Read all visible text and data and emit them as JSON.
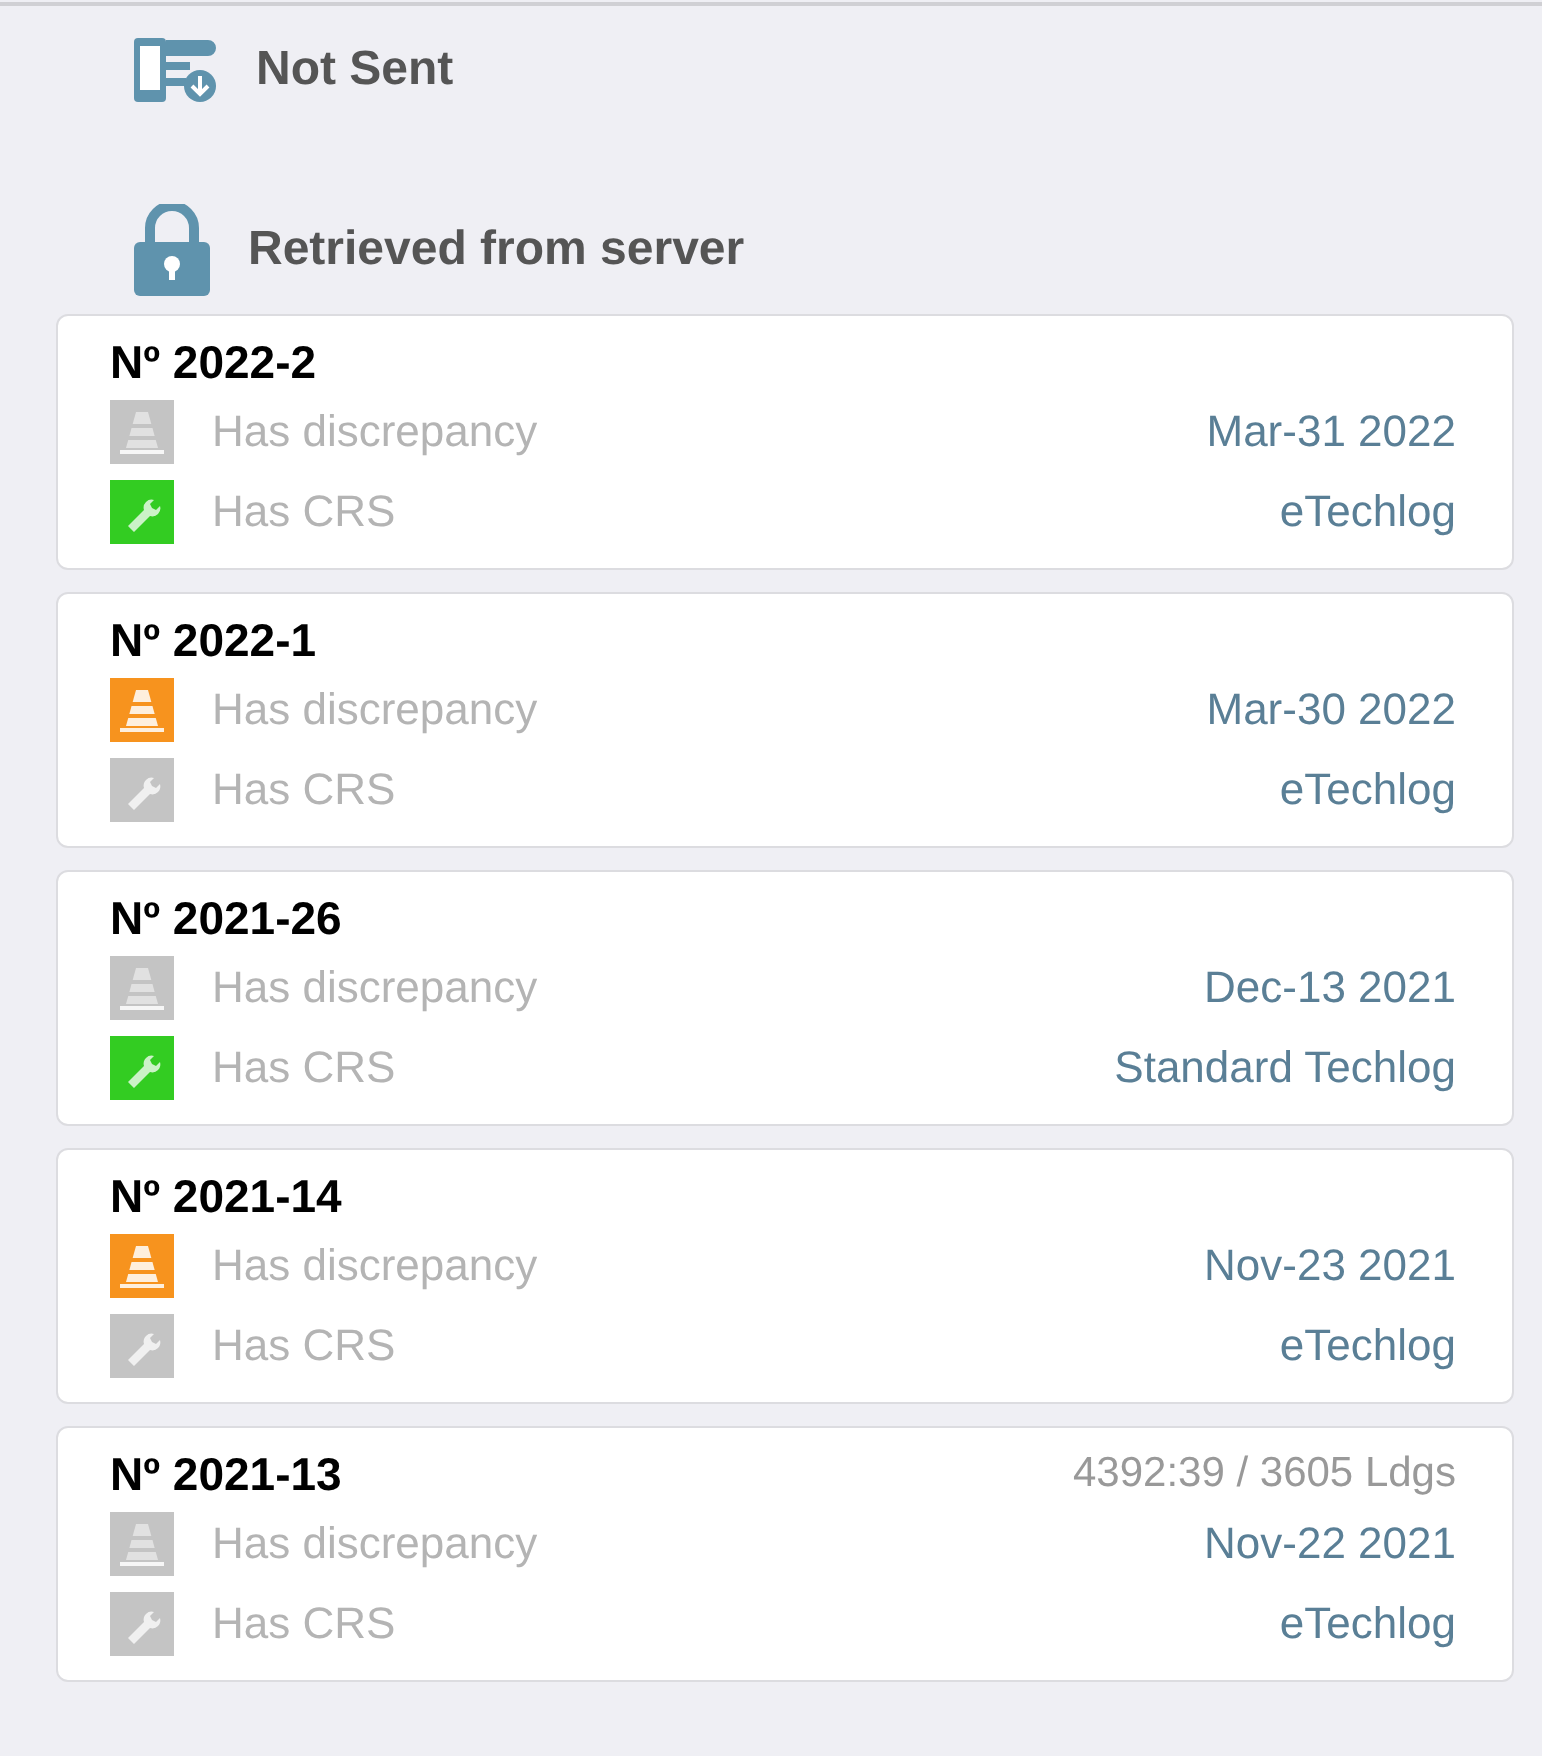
{
  "legend": [
    {
      "kind": "not-sent",
      "label": "Not Sent"
    },
    {
      "kind": "locked",
      "label": "Retrieved from server"
    }
  ],
  "records": [
    {
      "number": "Nº 2022-2",
      "discrepancy": {
        "label": "Has discrepancy",
        "on": false
      },
      "crs": {
        "label": "Has CRS",
        "on": true
      },
      "date": "Mar-31 2022",
      "source": "eTechlog"
    },
    {
      "number": "Nº 2022-1",
      "discrepancy": {
        "label": "Has discrepancy",
        "on": true
      },
      "crs": {
        "label": "Has CRS",
        "on": false
      },
      "date": "Mar-30 2022",
      "source": "eTechlog"
    },
    {
      "number": "Nº 2021-26",
      "discrepancy": {
        "label": "Has discrepancy",
        "on": false
      },
      "crs": {
        "label": "Has CRS",
        "on": true
      },
      "date": "Dec-13 2021",
      "source": "Standard Techlog"
    },
    {
      "number": "Nº 2021-14",
      "discrepancy": {
        "label": "Has discrepancy",
        "on": true
      },
      "crs": {
        "label": "Has CRS",
        "on": false
      },
      "date": "Nov-23 2021",
      "source": "eTechlog"
    },
    {
      "number": "Nº 2021-13",
      "meter": "4392:39 / 3605 Ldgs",
      "discrepancy": {
        "label": "Has discrepancy",
        "on": false
      },
      "crs": {
        "label": "Has CRS",
        "on": false
      },
      "date": "Nov-22 2021",
      "source": "eTechlog"
    }
  ]
}
